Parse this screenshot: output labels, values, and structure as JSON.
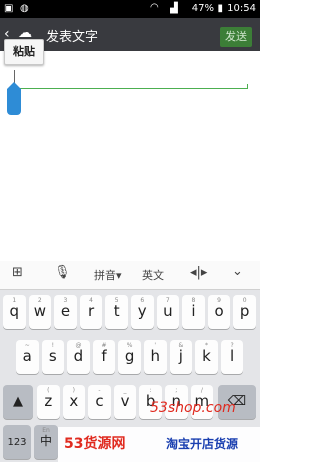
{
  "status": {
    "battery": "47%",
    "time": "10:54"
  },
  "header": {
    "back": "‹",
    "title": "发表文字",
    "send": "发送"
  },
  "popup": {
    "paste": "粘贴"
  },
  "toolbar": {
    "layout": "拼音",
    "english": "英文"
  },
  "keys": {
    "row1": [
      {
        "main": "q",
        "sub": "1"
      },
      {
        "main": "w",
        "sub": "2"
      },
      {
        "main": "e",
        "sub": "3"
      },
      {
        "main": "r",
        "sub": "4"
      },
      {
        "main": "t",
        "sub": "5"
      },
      {
        "main": "y",
        "sub": "6"
      },
      {
        "main": "u",
        "sub": "7"
      },
      {
        "main": "i",
        "sub": "8"
      },
      {
        "main": "o",
        "sub": "9"
      },
      {
        "main": "p",
        "sub": "0"
      }
    ],
    "row2": [
      {
        "main": "a",
        "sub": "~"
      },
      {
        "main": "s",
        "sub": "!"
      },
      {
        "main": "d",
        "sub": "@"
      },
      {
        "main": "f",
        "sub": "#"
      },
      {
        "main": "g",
        "sub": "%"
      },
      {
        "main": "h",
        "sub": "'"
      },
      {
        "main": "j",
        "sub": "&"
      },
      {
        "main": "k",
        "sub": "*"
      },
      {
        "main": "l",
        "sub": "?"
      }
    ],
    "row3": [
      {
        "main": "z",
        "sub": "("
      },
      {
        "main": "x",
        "sub": ")"
      },
      {
        "main": "c",
        "sub": "-"
      },
      {
        "main": "v",
        "sub": "_"
      },
      {
        "main": "b",
        "sub": ":"
      },
      {
        "main": "n",
        "sub": ";"
      },
      {
        "main": "m",
        "sub": "/"
      }
    ],
    "num": "123",
    "lang_top": "En",
    "lang": "中"
  },
  "watermark": {
    "top": "53shop.com",
    "left": "53货源网",
    "right": "淘宝开店货源"
  }
}
